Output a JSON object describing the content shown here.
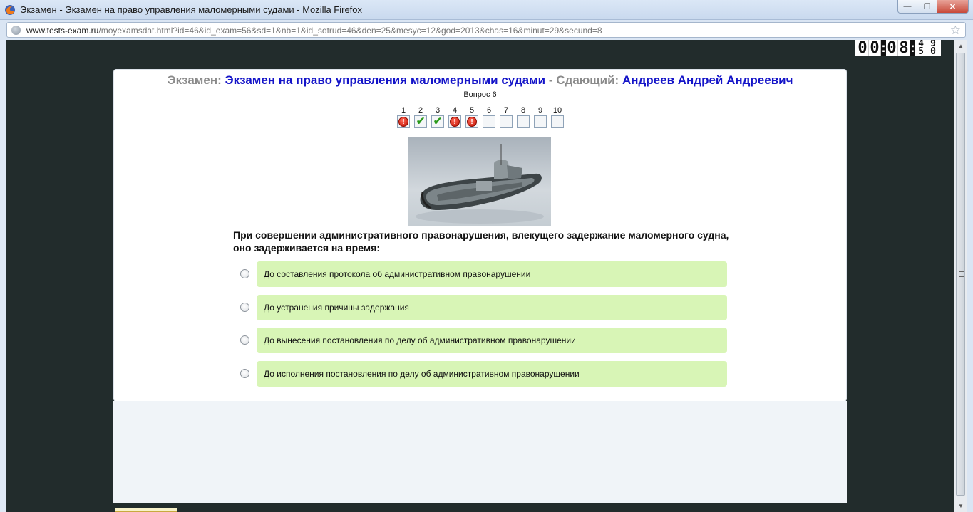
{
  "window": {
    "title": "Экзамен - Экзамен на право управления маломерными судами - Mozilla Firefox",
    "minimize": "—",
    "restore": "❐",
    "close": "✕"
  },
  "address": {
    "host": "www.tests-exam.ru",
    "path": "/moyexamsdat.html?id=46&id_exam=56&sd=1&nb=1&id_sotrud=46&den=25&mesyc=12&god=2013&chas=16&minut=29&secund=8"
  },
  "timer": {
    "h1": "0",
    "h2": "0",
    "m1": "0",
    "m2": "8",
    "s1_top": "4",
    "s1_bottom": "5",
    "s2_top": "9",
    "s2_bottom": "0"
  },
  "header": {
    "exam_label": "Экзамен:",
    "exam_name": "Экзамен на право управления маломерными судами",
    "dash": "-",
    "examinee_label": "Сдающий:",
    "examinee_name": "Андреев Андрей Андреевич"
  },
  "question_number": "Вопрос 6",
  "question_nav": [
    {
      "n": "1",
      "state": "wrong"
    },
    {
      "n": "2",
      "state": "correct"
    },
    {
      "n": "3",
      "state": "correct"
    },
    {
      "n": "4",
      "state": "wrong"
    },
    {
      "n": "5",
      "state": "wrong"
    },
    {
      "n": "6",
      "state": "empty"
    },
    {
      "n": "7",
      "state": "empty"
    },
    {
      "n": "8",
      "state": "empty"
    },
    {
      "n": "9",
      "state": "empty"
    },
    {
      "n": "10",
      "state": "empty"
    }
  ],
  "question_text": "При совершении административного правонарушения, влекущего задержание маломерного судна, оно задерживается на время:",
  "answers": [
    "До составления протокола об административном правонарушении",
    "До устранения причины задержания",
    "До вынесения постановления по делу об административном правонарушении",
    "До исполнения постановления по делу об административном правонарушении"
  ],
  "colors": {
    "answer_bg": "#d8f5b6",
    "header_blue": "#1414c8",
    "header_gray": "#8a8a8a",
    "page_bg": "#222c2c"
  }
}
